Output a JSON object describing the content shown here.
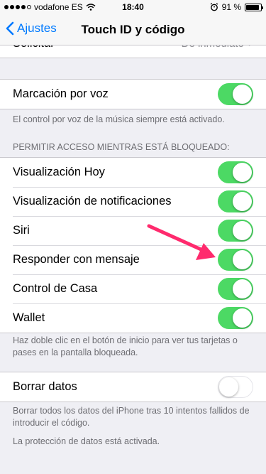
{
  "status_bar": {
    "carrier": "vodafone ES",
    "time": "18:40",
    "battery_percent": "91 %",
    "battery_level": 0.91,
    "signal_bars": 4
  },
  "nav": {
    "back_label": "Ajustes",
    "title": "Touch ID y código"
  },
  "request_row": {
    "label": "Solicitar",
    "value": "De inmediato"
  },
  "voice_dial": {
    "label": "Marcación por voz",
    "enabled": true,
    "footer": "El control por voz de la música siempre está activado."
  },
  "locked_access": {
    "header": "PERMITIR ACCESO MIENTRAS ESTÁ BLOQUEADO:",
    "items": [
      {
        "label": "Visualización Hoy",
        "enabled": true
      },
      {
        "label": "Visualización de notificaciones",
        "enabled": true
      },
      {
        "label": "Siri",
        "enabled": true
      },
      {
        "label": "Responder con mensaje",
        "enabled": true
      },
      {
        "label": "Control de Casa",
        "enabled": true
      },
      {
        "label": "Wallet",
        "enabled": true
      }
    ],
    "footer": "Haz doble clic en el botón de inicio para ver tus tarjetas o pases en la pantalla bloqueada."
  },
  "erase_data": {
    "label": "Borrar datos",
    "enabled": false,
    "footer": "Borrar todos los datos del iPhone tras 10 intentos fallidos de introducir el código.",
    "protection_note": "La protección de datos está activada."
  },
  "colors": {
    "accent": "#007aff",
    "toggle_on": "#4cd964",
    "annotation_arrow": "#ff2a6d"
  }
}
